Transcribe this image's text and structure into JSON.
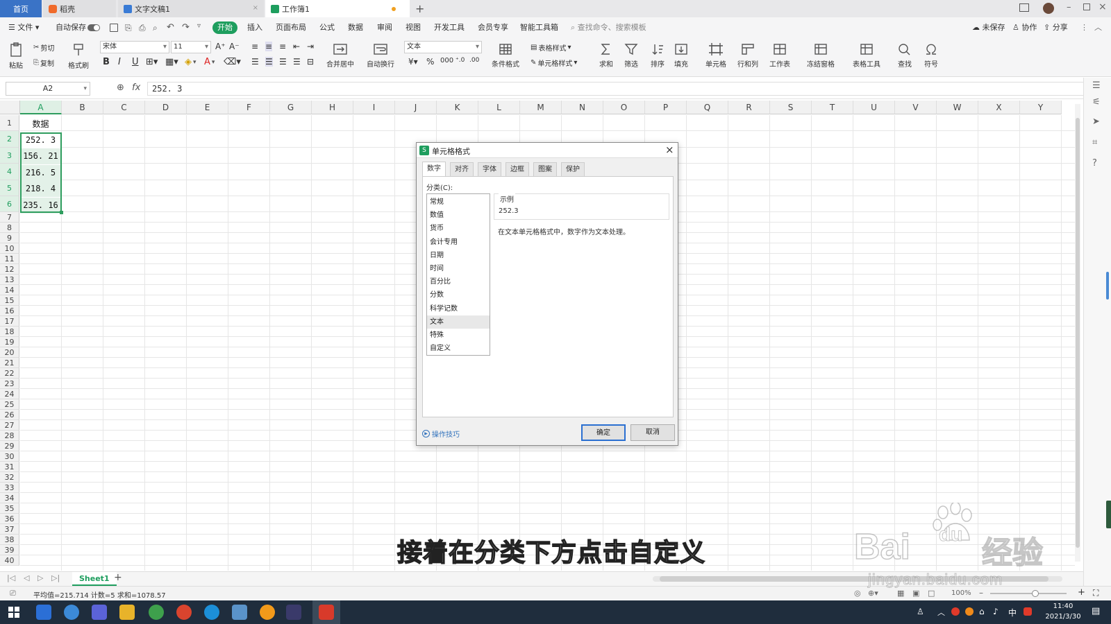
{
  "tabs": [
    {
      "label": "首页"
    },
    {
      "label": "稻壳"
    },
    {
      "label": "文字文稿1"
    },
    {
      "label": "工作簿1"
    }
  ],
  "menu": {
    "file": "文件",
    "autosave": "自动保存",
    "start": "开始",
    "insert": "插入",
    "layout": "页面布局",
    "formula": "公式",
    "data": "数据",
    "review": "审阅",
    "view": "视图",
    "dev": "开发工具",
    "member": "会员专享",
    "smart": "智能工具箱",
    "search": "查找命令、搜索模板",
    "unsaved": "未保存",
    "collab": "协作",
    "share": "分享"
  },
  "ribbon": {
    "paste": "粘贴",
    "cut": "剪切",
    "copy": "复制",
    "format_painter": "格式刷",
    "font": "宋体",
    "size": "11",
    "merge": "合并居中",
    "wrap": "自动换行",
    "numfmt": "文本",
    "cond": "条件格式",
    "tablestyle": "表格样式",
    "cellstyle": "单元格样式",
    "sum": "求和",
    "filter": "筛选",
    "sort": "排序",
    "fill": "填充",
    "cell": "单元格",
    "rowcol": "行和列",
    "sheet": "工作表",
    "freeze": "冻结窗格",
    "tools": "表格工具",
    "find": "查找",
    "symbol": "符号"
  },
  "formula_bar": {
    "name_box": "A2",
    "fx": "fx",
    "value": "252. 3"
  },
  "columns": [
    "A",
    "B",
    "C",
    "D",
    "E",
    "F",
    "G",
    "H",
    "I",
    "J",
    "K",
    "L",
    "M",
    "N",
    "O",
    "P",
    "Q",
    "R",
    "S",
    "T",
    "U",
    "V",
    "W",
    "X",
    "Y"
  ],
  "rows": [
    "1",
    "2",
    "3",
    "4",
    "5",
    "6",
    "7",
    "8",
    "9",
    "10",
    "11",
    "12",
    "13",
    "14",
    "15",
    "16",
    "17",
    "18",
    "19",
    "20",
    "21",
    "22",
    "23",
    "24",
    "25",
    "26",
    "27",
    "28",
    "29",
    "30",
    "31",
    "32",
    "33",
    "34",
    "35",
    "36",
    "37",
    "38",
    "39",
    "40"
  ],
  "cells": {
    "header": "数据",
    "values": [
      "252. 3",
      "156. 21",
      "216. 5",
      "218. 4",
      "235. 16"
    ]
  },
  "dialog": {
    "title": "单元格格式",
    "tabs": [
      "数字",
      "对齐",
      "字体",
      "边框",
      "图案",
      "保护"
    ],
    "category_label": "分类(C):",
    "categories": [
      "常规",
      "数值",
      "货币",
      "会计专用",
      "日期",
      "时间",
      "百分比",
      "分数",
      "科学记数",
      "文本",
      "特殊",
      "自定义"
    ],
    "selected_category": "文本",
    "sample_label": "示例",
    "sample_value": "252.3",
    "description": "在文本单元格格式中，数字作为文本处理。",
    "tips": "操作技巧",
    "ok": "确定",
    "cancel": "取消"
  },
  "sheet_tab": "Sheet1",
  "status_text": "平均值=215.714  计数=5  求和=1078.57",
  "zoom": "100%",
  "subtitle": "接着在分类下方点击自定义",
  "watermark": {
    "brand": "Bai",
    "paw": "du",
    "cn": "经验",
    "url": "jingyan.baidu.com"
  },
  "clock": {
    "time": "11:40",
    "date": "2021/3/30"
  },
  "ime": "中",
  "colors": {
    "accent": "#1e9e5e",
    "selection": "#2e9d5e",
    "title_bg": "#3273bd"
  }
}
